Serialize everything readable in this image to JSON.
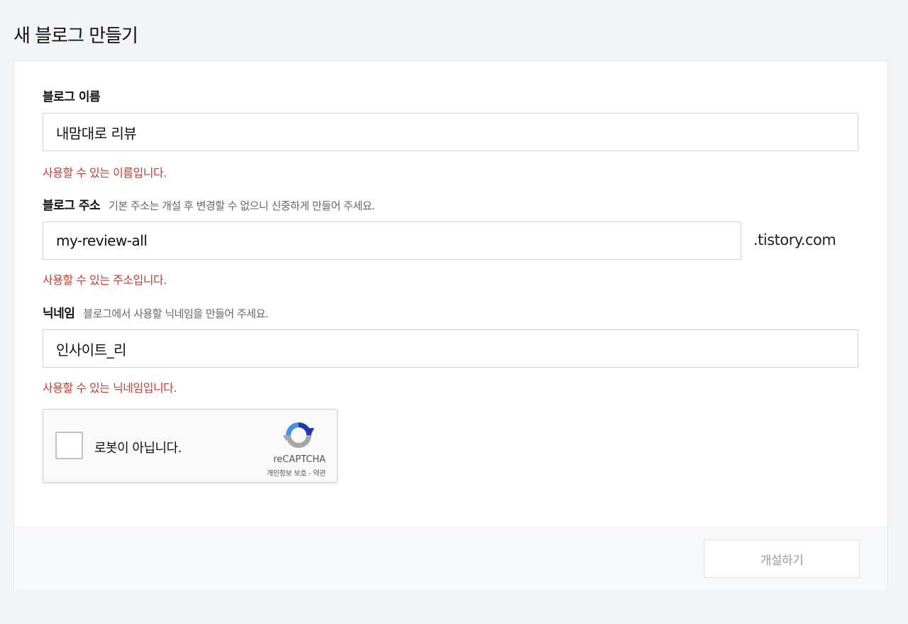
{
  "page": {
    "title": "새 블로그 만들기"
  },
  "form": {
    "blog_name": {
      "label": "블로그 이름",
      "value": "내맘대로 리뷰",
      "message": "사용할 수 있는 이름입니다."
    },
    "blog_address": {
      "label": "블로그 주소",
      "hint": "기본 주소는 개설 후 변경할 수 없으니 신중하게 만들어 주세요.",
      "value": "my-review-all",
      "suffix": ".tistory.com",
      "message": "사용할 수 있는 주소입니다."
    },
    "nickname": {
      "label": "닉네임",
      "hint": "블로그에서 사용할 닉네임을 만들어 주세요.",
      "value": "인사이트_리",
      "message": "사용할 수 있는 닉네임입니다."
    },
    "captcha": {
      "label": "로봇이 아닙니다.",
      "brand": "reCAPTCHA",
      "links": "개인정보 보호 - 약관",
      "icon": "recaptcha-icon"
    },
    "submit_label": "개설하기"
  },
  "colors": {
    "message": "#d0392b",
    "background": "#f3f4f6",
    "card": "#ffffff",
    "footer": "#f7f8fa"
  }
}
